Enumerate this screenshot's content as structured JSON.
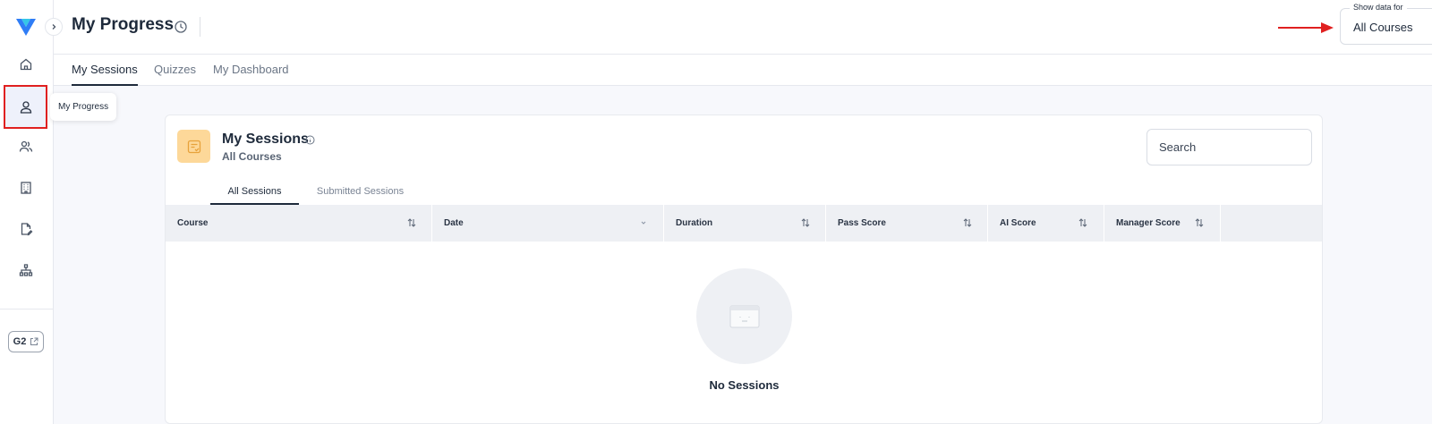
{
  "header": {
    "title": "My Progress",
    "filter": {
      "legend": "Show data for",
      "value": "All Courses"
    }
  },
  "sidebar": {
    "tooltip": "My Progress",
    "g2_label": "G2"
  },
  "tabs": [
    "My Sessions",
    "Quizzes",
    "My Dashboard"
  ],
  "card": {
    "title": "My Sessions",
    "subtitle": "All Courses",
    "search_placeholder": "Search",
    "subtabs": [
      "All Sessions",
      "Submitted Sessions"
    ],
    "columns": [
      "Course",
      "Date",
      "Duration",
      "Pass Score",
      "AI Score",
      "Manager Score"
    ],
    "empty_message": "No Sessions"
  },
  "colors": {
    "accent": "#1e2a3b",
    "highlight": "#e02020",
    "card_icon_bg": "#fdd899"
  }
}
